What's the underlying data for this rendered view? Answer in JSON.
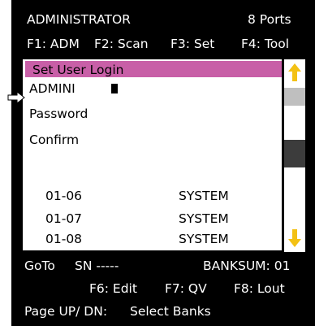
{
  "header": {
    "title": "ADMINISTRATOR",
    "ports": "8 Ports",
    "f1": "F1: ADM",
    "f2": "F2: Scan",
    "f3": "F3: Set",
    "f4": "F4: Tool"
  },
  "dialog": {
    "title": "Set User Login",
    "username_value": "ADMINI",
    "password_label": "Password",
    "confirm_label": "Confirm"
  },
  "list": {
    "rows": [
      {
        "id": "01-06",
        "name": "SYSTEM"
      },
      {
        "id": "01-07",
        "name": "SYSTEM"
      },
      {
        "id": "01-08",
        "name": "SYSTEM"
      }
    ]
  },
  "footer": {
    "goto": "GoTo",
    "sn": "SN -----",
    "banksum": "BANKSUM: 01",
    "f6": "F6: Edit",
    "f7": "F7: QV",
    "f8": "F8: Lout",
    "page_updn": "Page UP/ DN:",
    "select_banks": "Select Banks"
  },
  "colors": {
    "background": "#000000",
    "highlight": "#c85fa7",
    "scroll_arrow": "#f3c114",
    "text_on_dark": "#ffffff"
  },
  "icons": {
    "pointer": "right-arrow-icon",
    "scroll_up": "arrow-up-icon",
    "scroll_down": "arrow-down-icon"
  }
}
